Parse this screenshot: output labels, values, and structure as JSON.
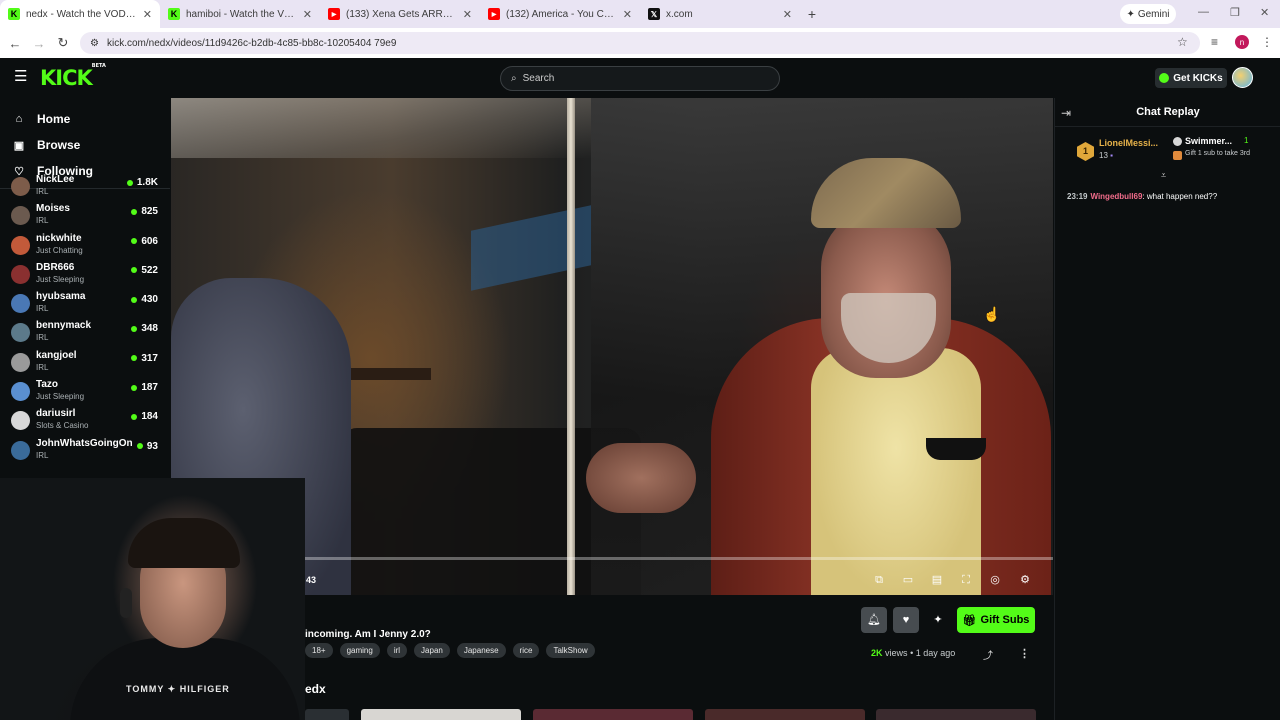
{
  "browser": {
    "tabs": [
      {
        "title": "nedx - Watch the VOD on Kick",
        "icon": "kick",
        "active": true
      },
      {
        "title": "hamiboi - Watch the VOD on Ki",
        "icon": "kick",
        "active": false
      },
      {
        "title": "(133) Xena Gets ARRESTED AG",
        "icon": "youtube",
        "active": false
      },
      {
        "title": "(132) America - You Can Do Ma",
        "icon": "youtube",
        "active": false
      },
      {
        "title": "x.com",
        "icon": "x",
        "active": false
      }
    ],
    "new_tab": "+",
    "gemini_label": "Gemini",
    "url": "kick.com/nedx/videos/11d9426c-b2db-4c85-bb8c-10205404 79e9",
    "profile_initial": "n"
  },
  "header": {
    "logo": "KICK",
    "logo_badge": "BETA",
    "search_placeholder": "Search",
    "get_kicks": "Get KICKs"
  },
  "sidebar": {
    "nav": [
      {
        "label": "Home",
        "icon": "home-icon"
      },
      {
        "label": "Browse",
        "icon": "browse-icon"
      },
      {
        "label": "Following",
        "icon": "heart-icon"
      }
    ],
    "channels": [
      {
        "name": "NickLee",
        "category": "IRL",
        "viewers": "1.8K",
        "color": "#7d5c4a"
      },
      {
        "name": "Moises",
        "category": "IRL",
        "viewers": "825",
        "color": "#6b5a4f"
      },
      {
        "name": "nickwhite",
        "category": "Just Chatting",
        "viewers": "606",
        "color": "#c25a3a"
      },
      {
        "name": "DBR666",
        "category": "Just Sleeping",
        "viewers": "522",
        "color": "#8a3030"
      },
      {
        "name": "hyubsama",
        "category": "IRL",
        "viewers": "430",
        "color": "#4a78b5"
      },
      {
        "name": "bennymack",
        "category": "IRL",
        "viewers": "348",
        "color": "#5c7a8a"
      },
      {
        "name": "kangjoel",
        "category": "IRL",
        "viewers": "317",
        "color": "#9a9a9a"
      },
      {
        "name": "Tazo",
        "category": "Just Sleeping",
        "viewers": "187",
        "color": "#5a8fd0"
      },
      {
        "name": "dariusirl",
        "category": "Slots & Casino",
        "viewers": "184",
        "color": "#d8d8d8"
      },
      {
        "name": "JohnWhatsGoingOn",
        "category": "IRL",
        "viewers": "93",
        "color": "#3a6b9a"
      }
    ]
  },
  "player": {
    "timecode": "43",
    "progress_fraction": 0.0,
    "controls": [
      "pip-icon",
      "theater-icon",
      "subtitles-icon",
      "fullscreen-icon",
      "speed-icon",
      "settings-icon"
    ]
  },
  "video_info": {
    "title": "incoming. Am I Jenny 2.0?",
    "tags": [
      "18+",
      "gaming",
      "irl",
      "Japan",
      "Japanese",
      "rice",
      "TalkShow"
    ],
    "gift_subs": "Gift Subs",
    "views_count": "2K",
    "views_label": "views",
    "separator": "•",
    "age": "1 day ago",
    "channel_heading": "edx"
  },
  "chat": {
    "title": "Chat Replay",
    "top_gifter": {
      "rank": "1",
      "name": "LionelMessi...",
      "count": "13"
    },
    "second": {
      "name": "Swimmer...",
      "count": "1",
      "cta": "Gift 1 sub to take 3rd"
    },
    "messages": [
      {
        "time": "23:19",
        "user": "Wingedbull69",
        "text": "what happen ned??"
      }
    ]
  },
  "webcam": {
    "shirt_text": "TOMMY ✦ HILFIGER"
  }
}
